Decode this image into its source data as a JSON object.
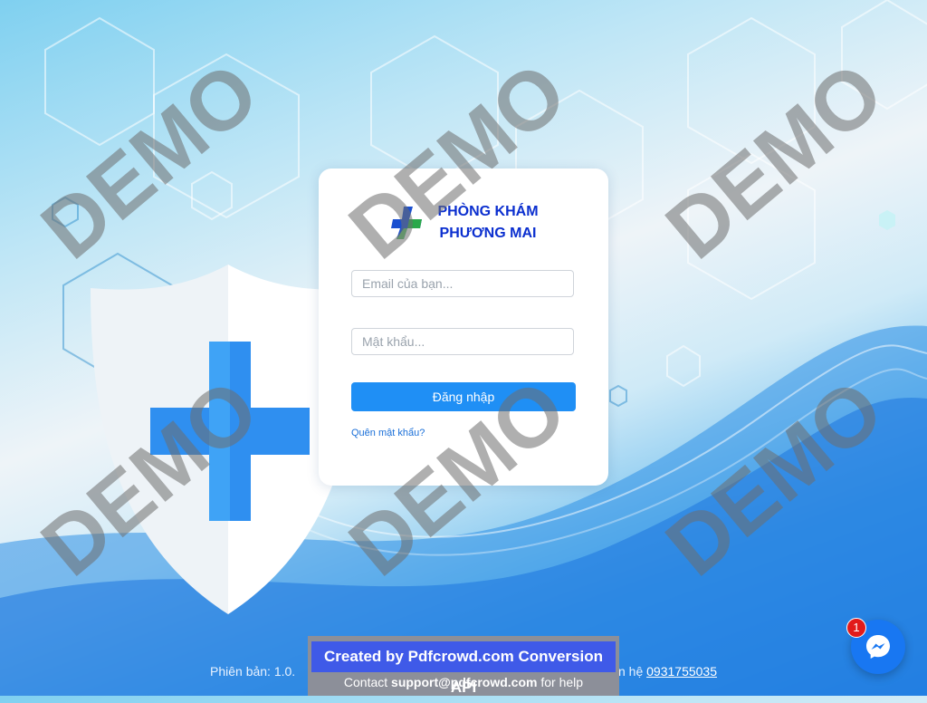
{
  "brand": {
    "line1": "PHÒNG KHÁM",
    "line2": "PHƯƠNG MAI",
    "color": "#0b2fcf"
  },
  "login_form": {
    "email_placeholder": "Email của bạn...",
    "password_placeholder": "Mật khẩu...",
    "submit_label": "Đăng nhập",
    "forgot_label": "Quên mật khẩu?",
    "accent": "#1f8ff5"
  },
  "footer": {
    "version": "Phiên bản: 1.0.",
    "contact_prefix": "n hệ",
    "phone": "0931755035"
  },
  "pdfcrowd_banner": {
    "title": "Created by Pdfcrowd.com Conversion API",
    "sub_prefix": "Contact",
    "sub_email": "support@pdfcrowd.com",
    "sub_suffix": "for help"
  },
  "messenger": {
    "badge_count": "1",
    "icon": "messenger-icon"
  },
  "watermark": {
    "text": "DEMO"
  }
}
